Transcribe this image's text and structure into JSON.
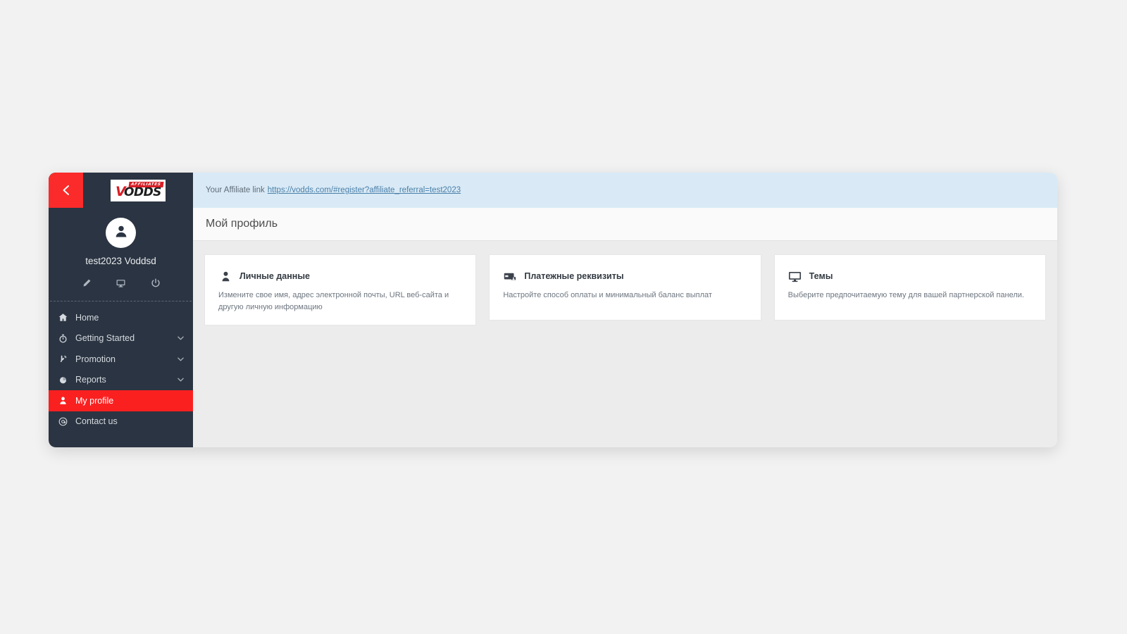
{
  "window": {
    "back_button_icon": "chevron-left-icon"
  },
  "sidebar": {
    "logo": {
      "mark": "V",
      "word": "ODDS",
      "badge": "AFFILIATES"
    },
    "user": {
      "name": "test2023 Voddsd",
      "avatar_icon": "user-avatar-icon"
    },
    "actions": [
      {
        "name": "edit-profile-action",
        "icon": "pencil-icon"
      },
      {
        "name": "display-action",
        "icon": "monitor-icon"
      },
      {
        "name": "logout-action",
        "icon": "power-icon"
      }
    ],
    "items": [
      {
        "label": "Home",
        "icon": "home-icon",
        "expandable": false,
        "active": false
      },
      {
        "label": "Getting Started",
        "icon": "stopwatch-icon",
        "expandable": true,
        "active": false
      },
      {
        "label": "Promotion",
        "icon": "hand-pointer-icon",
        "expandable": true,
        "active": false
      },
      {
        "label": "Reports",
        "icon": "pie-chart-icon",
        "expandable": true,
        "active": false
      },
      {
        "label": "My profile",
        "icon": "user-icon",
        "expandable": false,
        "active": true
      },
      {
        "label": "Contact us",
        "icon": "at-sign-icon",
        "expandable": false,
        "active": false
      }
    ]
  },
  "affiliate_bar": {
    "prefix": "Your Affiliate link",
    "link_text": "https://vodds.com/#register?affiliate_referral=test2023"
  },
  "header": {
    "title": "Мой профиль"
  },
  "cards": [
    {
      "icon": "person-icon",
      "title": "Личные данные",
      "description": "Измените свое имя, адрес электронной почты, URL веб-сайта и другую личную информацию"
    },
    {
      "icon": "credit-card-icon",
      "title": "Платежные реквизиты",
      "description": "Настройте способ оплаты и минимальный баланс выплат"
    },
    {
      "icon": "monitor-icon",
      "title": "Темы",
      "description": "Выберите предпочитаемую тему для вашей партнерской панели."
    }
  ],
  "colors": {
    "sidebar_bg": "#2b3442",
    "accent_red": "#fb2020",
    "affiliate_bar_bg": "#d9eaf6",
    "content_bg": "#ececec",
    "link": "#4a7fa8"
  }
}
